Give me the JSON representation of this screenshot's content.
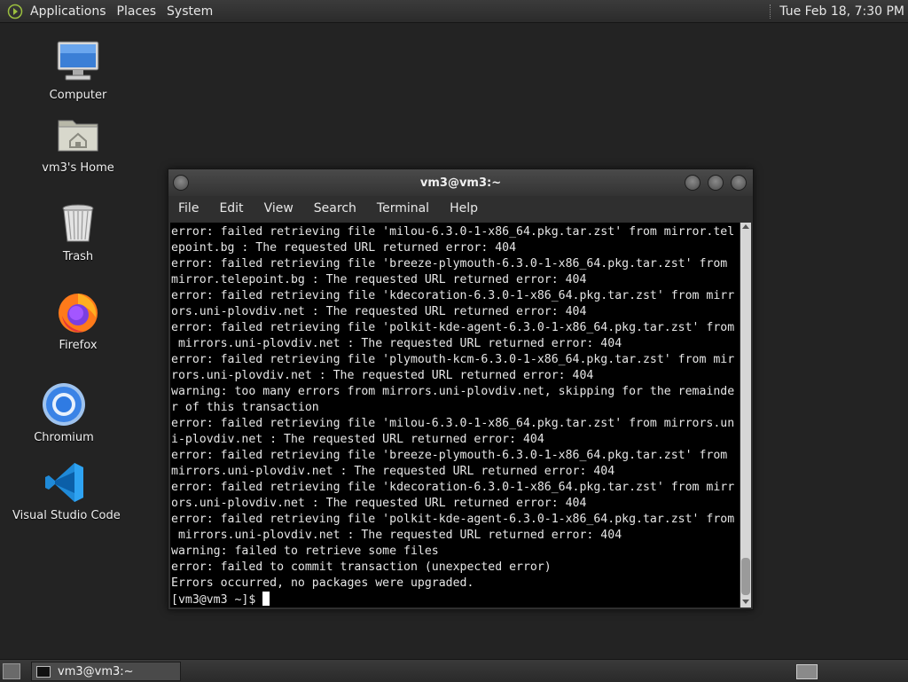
{
  "top_panel": {
    "menus": [
      "Applications",
      "Places",
      "System"
    ],
    "clock": "Tue Feb 18,  7:30 PM"
  },
  "desktop": {
    "icons": [
      {
        "label": "Computer",
        "icon": "computer-icon"
      },
      {
        "label": "vm3's Home",
        "icon": "home-folder-icon"
      },
      {
        "label": "Trash",
        "icon": "trash-icon"
      },
      {
        "label": "Firefox",
        "icon": "firefox-icon"
      },
      {
        "label": "Chromium",
        "icon": "chromium-icon"
      },
      {
        "label": "Visual Studio Code",
        "icon": "vscode-icon"
      }
    ]
  },
  "terminal": {
    "title": "vm3@vm3:~",
    "menu": [
      "File",
      "Edit",
      "View",
      "Search",
      "Terminal",
      "Help"
    ],
    "lines": [
      "error: failed retrieving file 'milou-6.3.0-1-x86_64.pkg.tar.zst' from mirror.tel",
      "epoint.bg : The requested URL returned error: 404",
      "error: failed retrieving file 'breeze-plymouth-6.3.0-1-x86_64.pkg.tar.zst' from",
      "mirror.telepoint.bg : The requested URL returned error: 404",
      "error: failed retrieving file 'kdecoration-6.3.0-1-x86_64.pkg.tar.zst' from mirr",
      "ors.uni-plovdiv.net : The requested URL returned error: 404",
      "error: failed retrieving file 'polkit-kde-agent-6.3.0-1-x86_64.pkg.tar.zst' from",
      " mirrors.uni-plovdiv.net : The requested URL returned error: 404",
      "error: failed retrieving file 'plymouth-kcm-6.3.0-1-x86_64.pkg.tar.zst' from mir",
      "rors.uni-plovdiv.net : The requested URL returned error: 404",
      "warning: too many errors from mirrors.uni-plovdiv.net, skipping for the remainde",
      "r of this transaction",
      "error: failed retrieving file 'milou-6.3.0-1-x86_64.pkg.tar.zst' from mirrors.un",
      "i-plovdiv.net : The requested URL returned error: 404",
      "error: failed retrieving file 'breeze-plymouth-6.3.0-1-x86_64.pkg.tar.zst' from",
      "mirrors.uni-plovdiv.net : The requested URL returned error: 404",
      "error: failed retrieving file 'kdecoration-6.3.0-1-x86_64.pkg.tar.zst' from mirr",
      "ors.uni-plovdiv.net : The requested URL returned error: 404",
      "error: failed retrieving file 'polkit-kde-agent-6.3.0-1-x86_64.pkg.tar.zst' from",
      " mirrors.uni-plovdiv.net : The requested URL returned error: 404",
      "warning: failed to retrieve some files",
      "error: failed to commit transaction (unexpected error)",
      "Errors occurred, no packages were upgraded."
    ],
    "prompt": "[vm3@vm3 ~]$ "
  },
  "taskbar": {
    "window_label": "vm3@vm3:~"
  }
}
